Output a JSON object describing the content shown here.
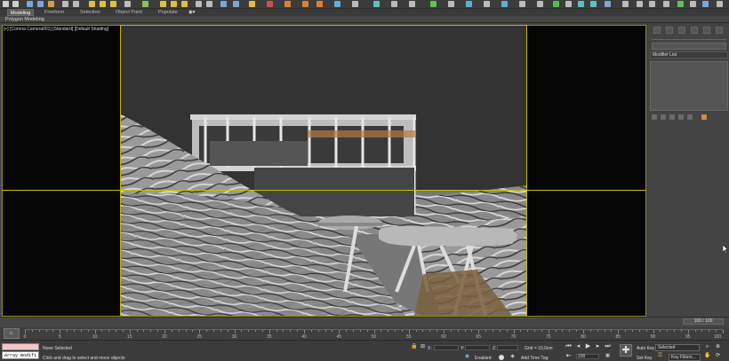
{
  "ribbon": {
    "tabs": [
      "Modeling",
      "Freeform",
      "Selection",
      "Object Paint",
      "Populate"
    ],
    "active_tab": "Modeling",
    "sub_label": "Polygon Modeling"
  },
  "viewport": {
    "label": "[+] [Corona Camera001] [Standard] [Default Shading]"
  },
  "command_panel": {
    "modifier_list_label": "Modifier List"
  },
  "timeline": {
    "frame_counter": "100 / 100",
    "ticks": [
      "0",
      "5",
      "10",
      "15",
      "20",
      "25",
      "30",
      "35",
      "40",
      "45",
      "50",
      "55",
      "60",
      "65",
      "70",
      "75",
      "80",
      "85",
      "90",
      "95",
      "100"
    ]
  },
  "status": {
    "maxscript_input": "Array modifi",
    "selection_text": "None Selected",
    "prompt_text": "Click and drag to select and move objects",
    "x_label": "X:",
    "y_label": "Y:",
    "z_label": "Z:",
    "grid_text": "Grid = 10,0cm",
    "enabled_label": "Enabled:",
    "add_time_tag": "Add Time Tag",
    "auto_key": "Auto Key",
    "set_key": "Set Key",
    "selected_dropdown": "Selected",
    "key_filters": "Key Filters...",
    "frame_field": "100"
  }
}
